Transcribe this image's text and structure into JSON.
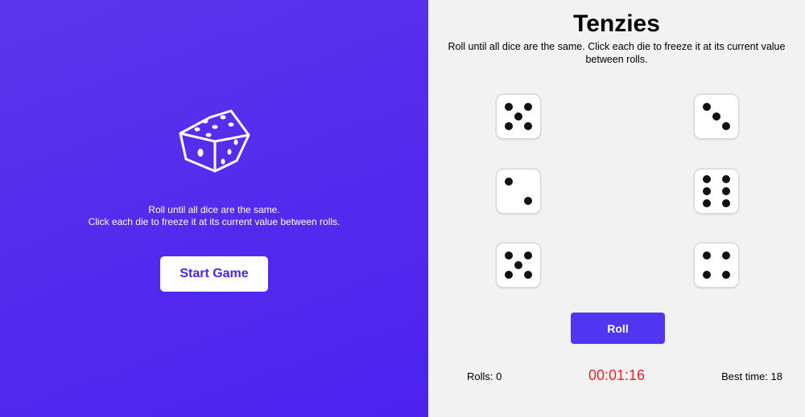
{
  "start_screen": {
    "logo_icon": "dice-icon",
    "instructions_line1": "Roll until all dice are the same.",
    "instructions_line2": "Click each die to freeze it at its current value between rolls.",
    "start_label": "Start Game"
  },
  "game": {
    "title": "Tenzies",
    "instructions": "Roll until all dice are the same. Click each die to freeze it at its current value between rolls.",
    "dice_values": [
      5,
      3,
      2,
      6,
      5,
      4
    ],
    "roll_label": "Roll",
    "rolls_text": "Rolls: 0",
    "timer_text": "00:01:16",
    "best_time_text": "Best time: 18"
  },
  "colors": {
    "accent": "#5035f1",
    "left_gradient_start": "#5b35ec",
    "left_gradient_end": "#4b22ef",
    "timer": "#e8232a",
    "panel_bg": "#f2f2f2"
  }
}
